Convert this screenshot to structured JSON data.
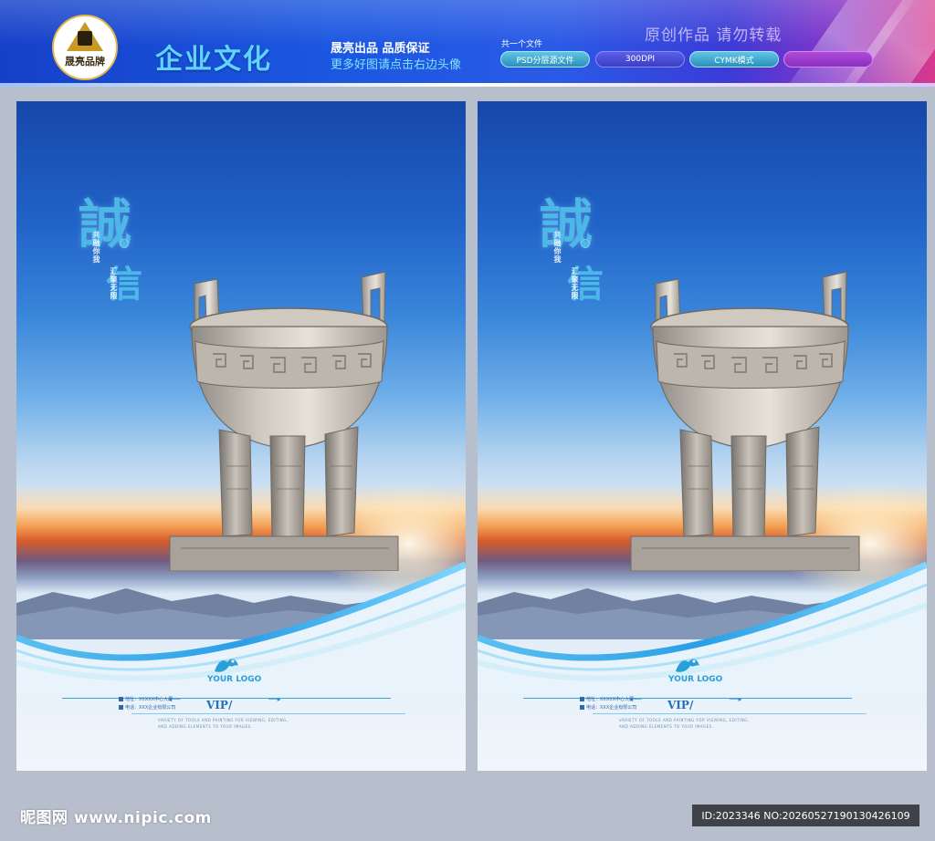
{
  "banner": {
    "logo_text": "晟亮品牌",
    "title": "企业文化",
    "tag_line1": "晟亮出品  品质保证",
    "tag_line2": "更多好图请点击右边头像",
    "file_label": "共一个文件",
    "pills": [
      "PSD分层源文件",
      "300DPI",
      "CYMK模式",
      ""
    ],
    "notice": "原创作品 请勿转载",
    "colors": {
      "accent": "#5fd4ff",
      "banner_start": "#1640c8",
      "banner_end": "#d8388c"
    }
  },
  "posters": [
    {
      "char_main": "誠",
      "char_second": "信",
      "vertical_a": "共融你我",
      "vertical_b": "汇聚无限",
      "logo_text": "YOUR LOGO",
      "vip": "VIP/",
      "contact_line1": "地址：XXXXX中心大厦",
      "contact_line2": "电话：XXX企业有限公司",
      "tagline1": "VARIETY OF TOOLS AND PAINTING FOR VIEWING, EDITING,",
      "tagline2": "AND ADDING ELEMENTS TO YOUR IMAGES."
    },
    {
      "char_main": "誠",
      "char_second": "信",
      "vertical_a": "共融你我",
      "vertical_b": "汇聚无限",
      "logo_text": "YOUR LOGO",
      "vip": "VIP/",
      "contact_line1": "地址：XXXXX中心大厦",
      "contact_line2": "电话：XXX企业有限公司",
      "tagline1": "VARIETY OF TOOLS AND PAINTING FOR VIEWING, EDITING,",
      "tagline2": "AND ADDING ELEMENTS TO YOUR IMAGES."
    }
  ],
  "footer": {
    "watermark": "昵图网 www.nipic.com",
    "id_text": "ID:2023346 NO:20260527190130426109"
  }
}
